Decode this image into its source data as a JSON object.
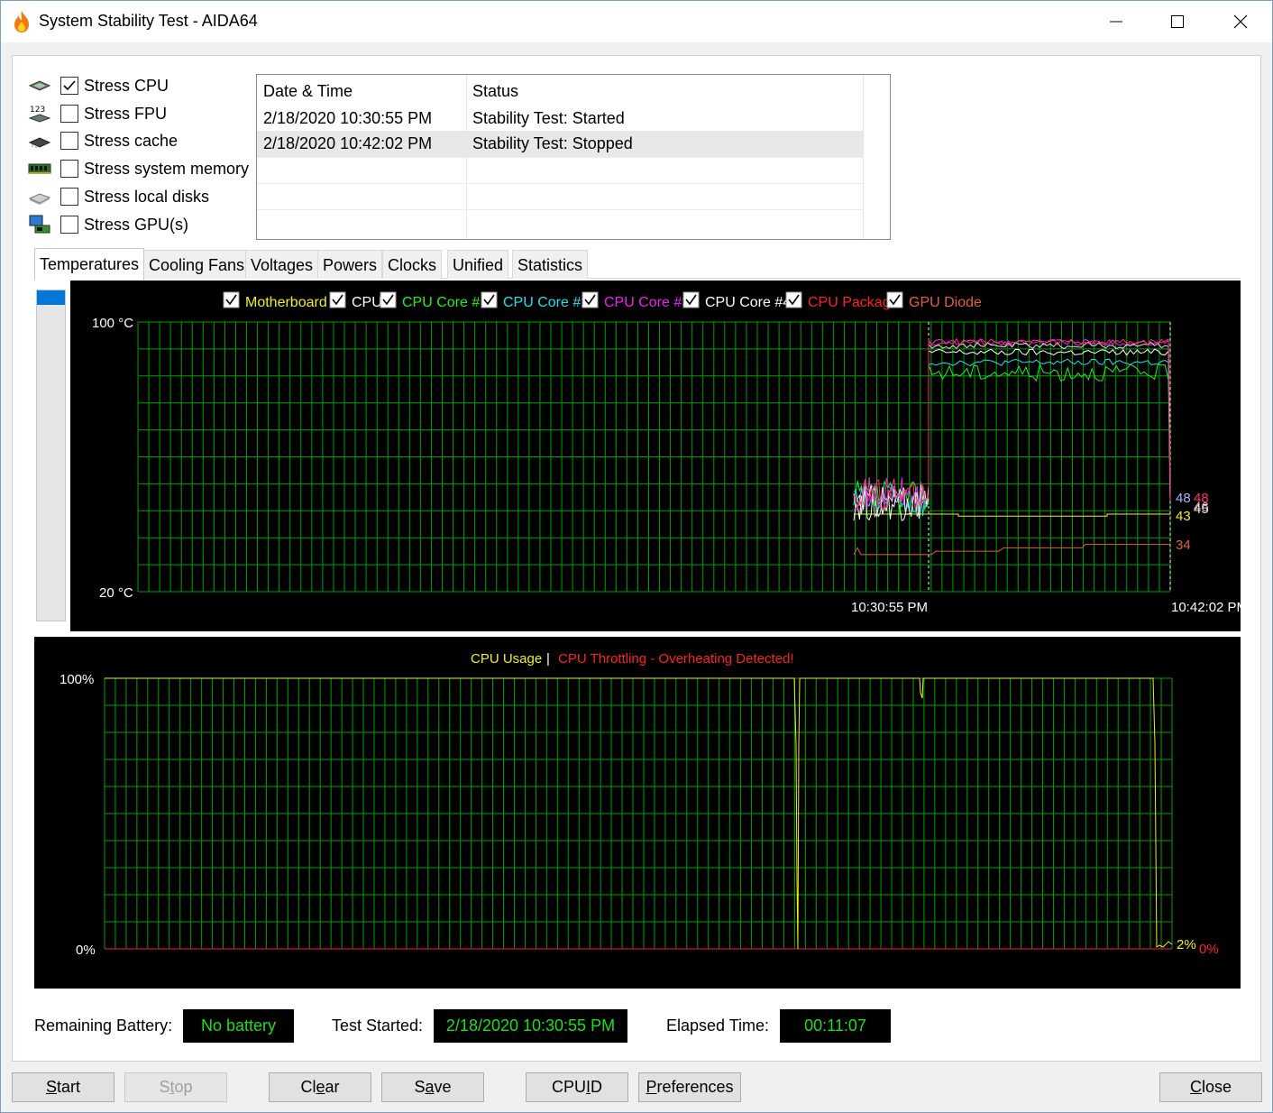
{
  "window": {
    "title": "System Stability Test - AIDA64",
    "controls": [
      "minimize",
      "maximize",
      "close"
    ]
  },
  "stress_options": [
    {
      "label": "Stress CPU",
      "checked": true,
      "icon": "cpu-chip-icon"
    },
    {
      "label": "Stress FPU",
      "checked": false,
      "icon": "fpu-123-icon"
    },
    {
      "label": "Stress cache",
      "checked": false,
      "icon": "cache-chip-icon"
    },
    {
      "label": "Stress system memory",
      "checked": false,
      "icon": "memory-module-icon"
    },
    {
      "label": "Stress local disks",
      "checked": false,
      "icon": "disk-drive-icon"
    },
    {
      "label": "Stress GPU(s)",
      "checked": false,
      "icon": "gpu-monitor-icon"
    }
  ],
  "log": {
    "headers": [
      "Date & Time",
      "Status"
    ],
    "rows": [
      {
        "datetime": "2/18/2020 10:30:55 PM",
        "status": "Stability Test: Started"
      },
      {
        "datetime": "2/18/2020 10:42:02 PM",
        "status": "Stability Test: Stopped"
      }
    ]
  },
  "tabs": [
    "Temperatures",
    "Cooling Fans",
    "Voltages",
    "Powers",
    "Clocks",
    "Unified",
    "Statistics"
  ],
  "active_tab": "Temperatures",
  "temperature_chart": {
    "legend": [
      {
        "label": "Motherboard",
        "color": "#f0f020",
        "checked": true
      },
      {
        "label": "CPU",
        "color": "#ffffff",
        "checked": true
      },
      {
        "label": "CPU Core #1",
        "color": "#20f020",
        "checked": true
      },
      {
        "label": "CPU Core #2",
        "color": "#20e0f0",
        "checked": true
      },
      {
        "label": "CPU Core #3",
        "color": "#f020f0",
        "checked": true
      },
      {
        "label": "CPU Core #4",
        "color": "#ffffff",
        "checked": true
      },
      {
        "label": "CPU Package",
        "color": "#ff2020",
        "checked": true
      },
      {
        "label": "GPU Diode",
        "color": "#e06040",
        "checked": true
      }
    ],
    "y_max_label": "100 °C",
    "y_min_label": "20 °C",
    "x_labels": [
      "10:30:55 PM",
      "10:42:02 PM"
    ],
    "end_values": [
      {
        "text": "48",
        "color": "#aab4ff"
      },
      {
        "text": "48",
        "color": "#ff3070"
      },
      {
        "text": "46",
        "color": "#f0a0c0"
      },
      {
        "text": "45",
        "color": "#e0e0e0"
      },
      {
        "text": "43",
        "color": "#f0f020"
      },
      {
        "text": "34",
        "color": "#e06040"
      }
    ],
    "grid_color": "#00a000"
  },
  "chart_data": {
    "type": "line",
    "title": "",
    "ylim": [
      20,
      100
    ],
    "x": [
      "10:30:55 PM",
      "10:42:02 PM"
    ],
    "series": [
      {
        "name": "Motherboard",
        "start": 43,
        "end": 43
      },
      {
        "name": "CPU",
        "start": 48,
        "end": 45
      },
      {
        "name": "CPU Core #1",
        "start": 48,
        "end": 48
      },
      {
        "name": "CPU Core #2",
        "start": 48,
        "end": 48
      },
      {
        "name": "CPU Core #3",
        "start": 48,
        "end": 46
      },
      {
        "name": "CPU Core #4",
        "start": 48,
        "end": 45
      },
      {
        "name": "CPU Package",
        "start": 48,
        "end": 48
      },
      {
        "name": "GPU Diode",
        "start": 31,
        "end": 34
      }
    ]
  },
  "usage_chart": {
    "title_left": "CPU Usage",
    "separator": "|",
    "title_right": "CPU Throttling - Overheating Detected!",
    "y_max_label": "100%",
    "y_min_label": "0%",
    "end_usage": "2%",
    "end_throttle": "0%",
    "usage_color": "#f0f020",
    "throttle_color": "#ff2020"
  },
  "status": {
    "battery_label": "Remaining Battery:",
    "battery_value": "No battery",
    "started_label": "Test Started:",
    "started_value": "2/18/2020 10:30:55 PM",
    "elapsed_label": "Elapsed Time:",
    "elapsed_value": "00:11:07"
  },
  "buttons": {
    "start": {
      "pre": "",
      "u": "S",
      "post": "tart"
    },
    "stop": {
      "pre": "S",
      "u": "t",
      "post": "op"
    },
    "clear": {
      "pre": "Cl",
      "u": "e",
      "post": "ar"
    },
    "save": {
      "pre": "S",
      "u": "a",
      "post": "ve"
    },
    "cpuid": {
      "pre": "CPU",
      "u": "I",
      "post": "D"
    },
    "preferences": {
      "pre": "",
      "u": "P",
      "post": "references"
    },
    "close": {
      "pre": "",
      "u": "C",
      "post": "lose"
    }
  }
}
